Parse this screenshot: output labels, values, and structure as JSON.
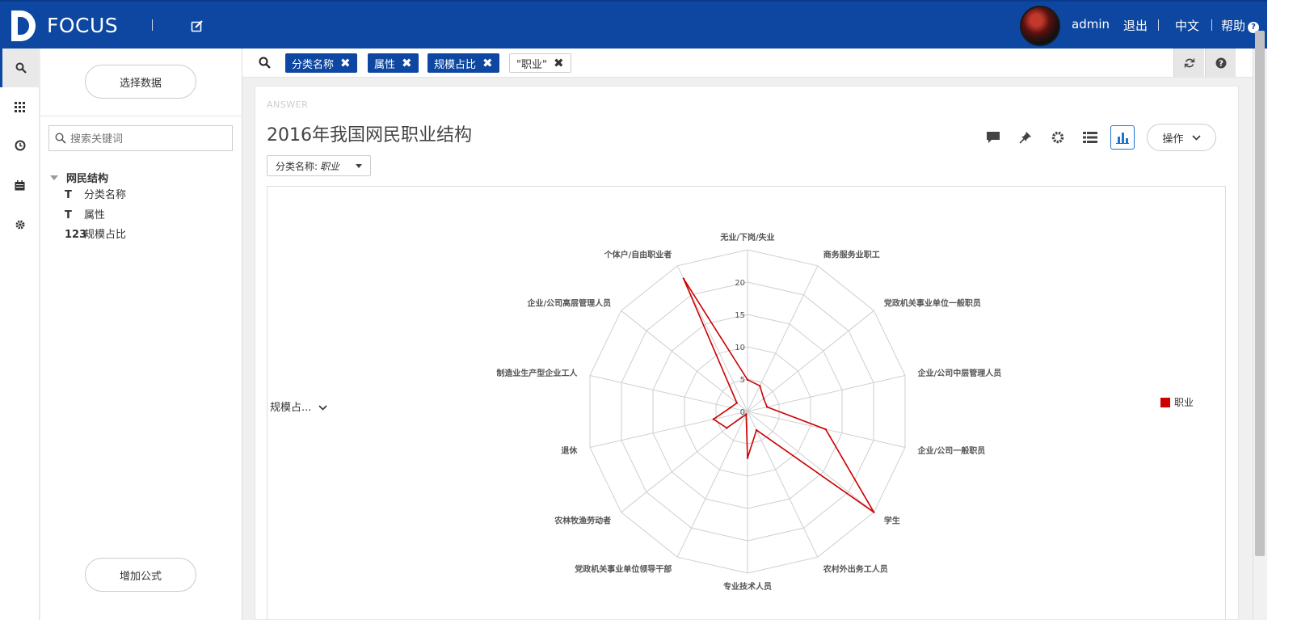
{
  "header": {
    "brand": "FOCUS",
    "user": "admin",
    "logout": "退出",
    "language": "中文",
    "help": "帮助",
    "accent": "#0d47a1"
  },
  "rail": {
    "icons": [
      "search-icon",
      "grid-icon",
      "history-icon",
      "calendar-icon",
      "gear-icon"
    ]
  },
  "panel": {
    "select_data": "选择数据",
    "search_placeholder": "搜索关键词",
    "tree_root": "网民结构",
    "fields": [
      {
        "type_label": "T",
        "label": "分类名称"
      },
      {
        "type_label": "T",
        "label": "属性"
      },
      {
        "type_label": "123",
        "label": "规模占比"
      }
    ],
    "add_formula": "增加公式"
  },
  "query": {
    "chips": [
      "分类名称",
      "属性",
      "规模占比"
    ],
    "value_chip": "\"职业\""
  },
  "answer": {
    "label": "ANSWER",
    "title": "2016年我国网民职业结构",
    "filter_key": "分类名称:",
    "filter_value": "职业",
    "operate": "操作",
    "measure_selector": "规模占..."
  },
  "chart_data": {
    "type": "radar",
    "title": "2016年我国网民职业结构",
    "categories": [
      "无业/下岗/失业",
      "商务服务业职工",
      "党政机关事业单位一般职员",
      "企业/公司中层管理人员",
      "企业/公司一般职员",
      "学生",
      "农村外出务工人员",
      "专业技术人员",
      "党政机关事业单位领导干部",
      "农林牧渔劳动者",
      "退休",
      "制造业生产型企业工人",
      "企业/公司高层管理人员",
      "个体户/自由职业者"
    ],
    "series": [
      {
        "name": "职业",
        "color": "#cc0000",
        "values": [
          4.9,
          4.4,
          3.2,
          3.1,
          12.4,
          25.0,
          3.2,
          7.2,
          0.5,
          4.1,
          5.4,
          2.7,
          2.1,
          22.8
        ]
      }
    ],
    "radial_ticks": [
      "0",
      "5",
      "10",
      "15",
      "20"
    ],
    "rmax": 25,
    "legend_position": "right",
    "grid": true
  }
}
